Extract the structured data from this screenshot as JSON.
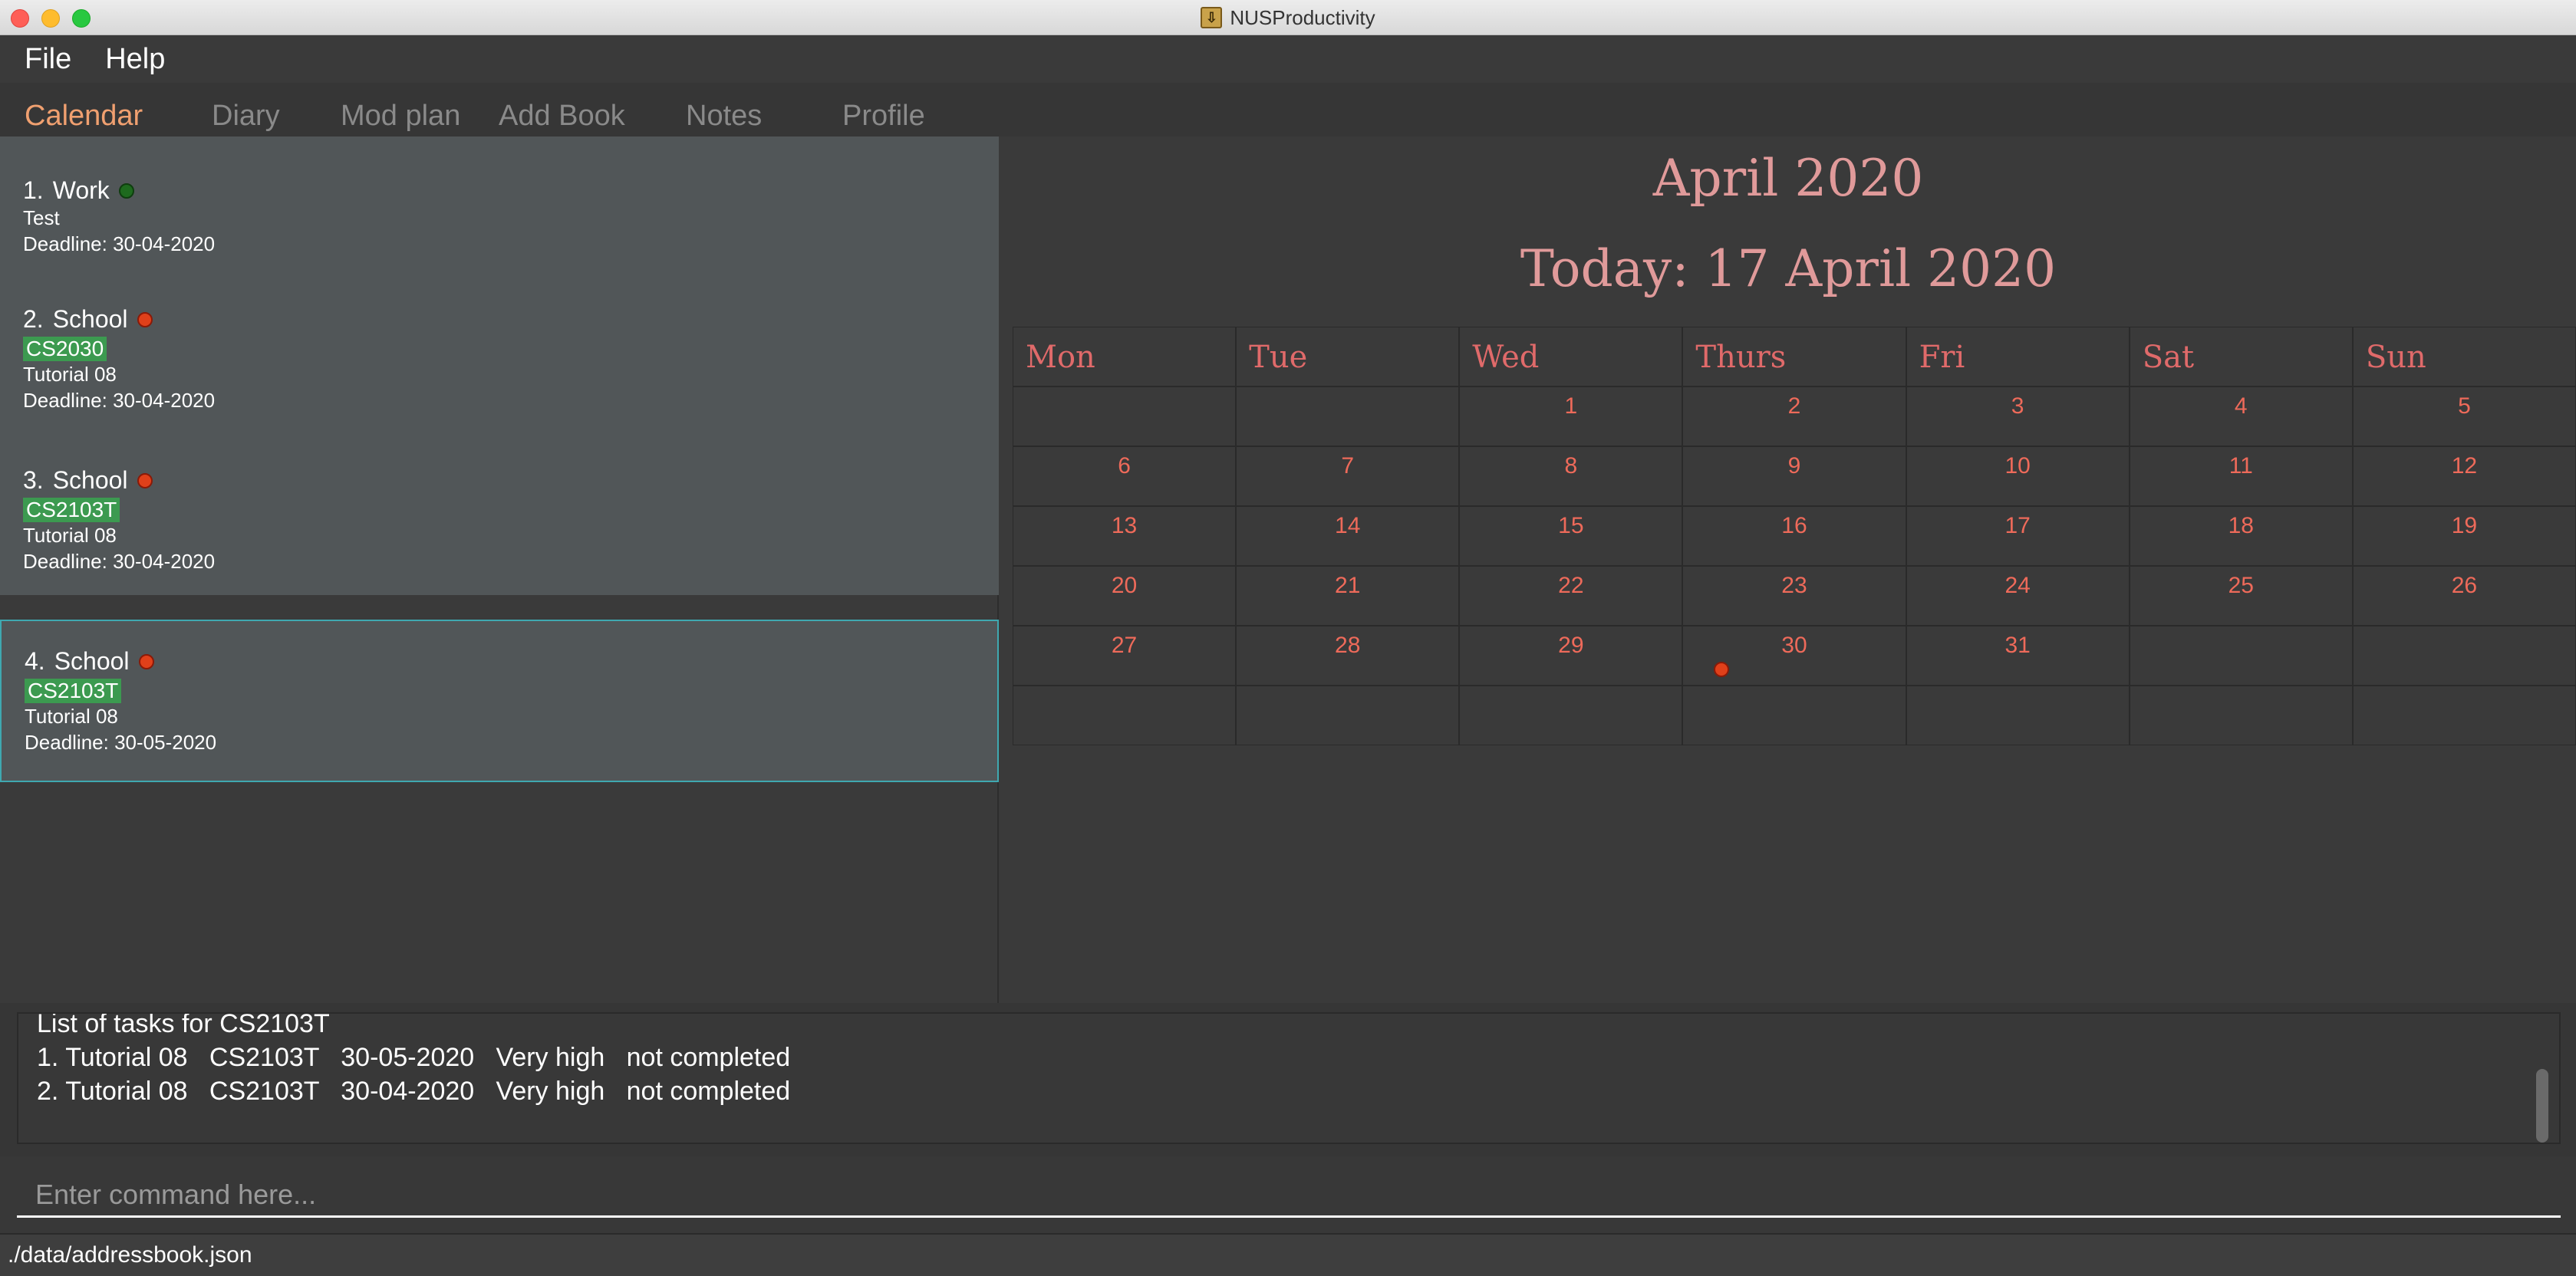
{
  "window": {
    "title": "NUSProductivity"
  },
  "menu": {
    "file": "File",
    "help": "Help"
  },
  "tabs": [
    {
      "label": "Calendar",
      "active": true
    },
    {
      "label": "Diary"
    },
    {
      "label": "Mod plan"
    },
    {
      "label": "Add Book"
    },
    {
      "label": "Notes"
    },
    {
      "label": "Profile"
    }
  ],
  "tasks": [
    {
      "index": "1.",
      "category": "Work",
      "status_color": "green",
      "tag": "",
      "name": "Test",
      "deadline": "Deadline: 30-04-2020"
    },
    {
      "index": "2.",
      "category": "School",
      "status_color": "red",
      "tag": "CS2030",
      "name": "Tutorial 08",
      "deadline": "Deadline: 30-04-2020"
    },
    {
      "index": "3.",
      "category": "School",
      "status_color": "red",
      "tag": "CS2103T",
      "name": "Tutorial 08",
      "deadline": "Deadline: 30-04-2020"
    },
    {
      "index": "4.",
      "category": "School",
      "status_color": "red",
      "tag": "CS2103T",
      "name": "Tutorial 08",
      "deadline": "Deadline: 30-05-2020",
      "selected": true
    }
  ],
  "calendar": {
    "month_title": "April 2020",
    "today": "Today: 17 April 2020",
    "weekdays": [
      "Mon",
      "Tue",
      "Wed",
      "Thurs",
      "Fri",
      "Sat",
      "Sun"
    ],
    "weeks": [
      [
        "",
        "",
        "1",
        "2",
        "3",
        "4",
        "5"
      ],
      [
        "6",
        "7",
        "8",
        "9",
        "10",
        "11",
        "12"
      ],
      [
        "13",
        "14",
        "15",
        "16",
        "17",
        "18",
        "19"
      ],
      [
        "20",
        "21",
        "22",
        "23",
        "24",
        "25",
        "26"
      ],
      [
        "27",
        "28",
        "29",
        "30",
        "31",
        "",
        ""
      ],
      [
        "",
        "",
        "",
        "",
        "",
        "",
        ""
      ]
    ],
    "event_days": [
      "30"
    ]
  },
  "result": {
    "lines": [
      "List of tasks for CS2103T",
      "1. Tutorial 08   CS2103T   30-05-2020   Very high   not completed",
      "2. Tutorial 08   CS2103T   30-04-2020   Very high   not completed"
    ]
  },
  "command": {
    "placeholder": "Enter command here..."
  },
  "status": {
    "path": "./data/addressbook.json"
  },
  "colors": {
    "accent_tab": "#f0a070",
    "calendar_title": "#e09a9a",
    "calendar_day": "#ee6a5a",
    "tag_bg": "#3c9a50",
    "selected_border": "#3fa8b0"
  }
}
